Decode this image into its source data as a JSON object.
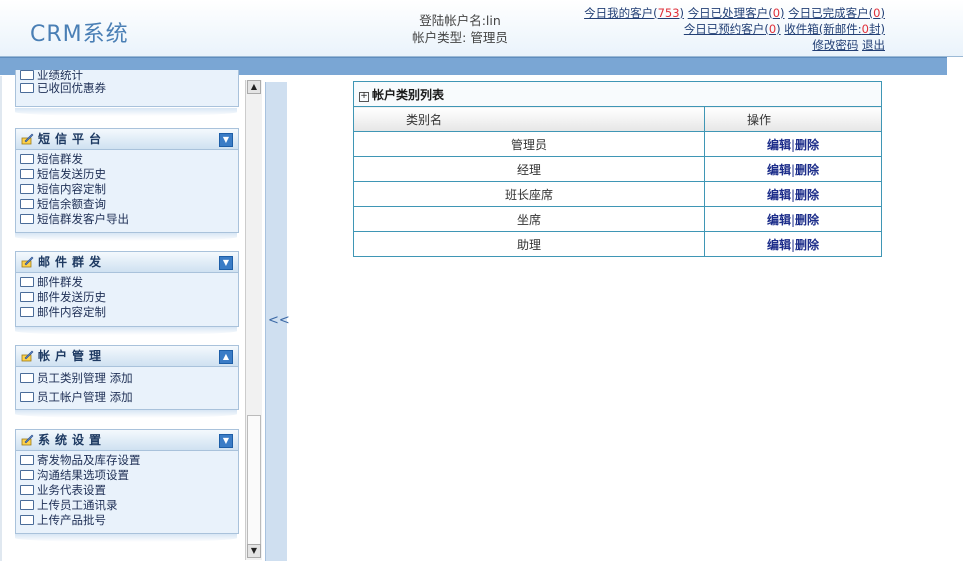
{
  "app": {
    "title": "CRM系统"
  },
  "login": {
    "user_label": "登陆帐户名:lin",
    "type_label": "帐户类型: 管理员"
  },
  "stats": {
    "my_customers_label": "今日我的客户",
    "my_customers_count": "753",
    "handled_label": "今日已处理客户",
    "handled_count": "0",
    "completed_label": "今日已完成客户",
    "completed_count": "0",
    "reserved_label": "今日已预约客户",
    "reserved_count": "0",
    "inbox_label": "收件箱(新邮件:",
    "inbox_count": "0",
    "inbox_suffix": "封)",
    "change_password": "修改密码",
    "logout": "退出"
  },
  "sidebar": {
    "partial_menu": {
      "items": [
        "业绩统计",
        "已收回优惠券"
      ]
    },
    "sms": {
      "title": "短信平台",
      "items": [
        "短信群发",
        "短信发送历史",
        "短信内容定制",
        "短信余额查询",
        "短信群发客户导出"
      ]
    },
    "mail": {
      "title": "邮件群发",
      "items": [
        "邮件群发",
        "邮件发送历史",
        "邮件内容定制"
      ]
    },
    "account": {
      "title": "帐户管理",
      "items": [
        {
          "label": "员工类别管理",
          "add": "添加"
        },
        {
          "label": "员工帐户管理",
          "add": "添加"
        }
      ]
    },
    "system": {
      "title": "系统设置",
      "items": [
        "寄发物品及库存设置",
        "沟通结果选项设置",
        "业务代表设置",
        "上传员工通讯录",
        "上传产品批号"
      ]
    }
  },
  "splitter": {
    "label": "<<"
  },
  "table": {
    "caption": "帐户类别列表",
    "columns": [
      "类别名",
      "操作"
    ],
    "rows": [
      {
        "name": "管理员",
        "edit": "编辑",
        "sep": "|",
        "delete": "删除"
      },
      {
        "name": "经理",
        "edit": "编辑",
        "sep": "|",
        "delete": "删除"
      },
      {
        "name": "班长座席",
        "edit": "编辑",
        "sep": "|",
        "delete": "删除"
      },
      {
        "name": "坐席",
        "edit": "编辑",
        "sep": "|",
        "delete": "删除"
      },
      {
        "name": "助理",
        "edit": "编辑",
        "sep": "|",
        "delete": "删除"
      }
    ]
  },
  "icons": {
    "folder": "folder-icon",
    "menu_title": "pencil-icon",
    "collapse": "collapse-icon",
    "expand": "expand-icon"
  },
  "colors": {
    "header_bar": "#7aa6d4",
    "count": "#e0303a",
    "link": "#223f75",
    "table_border": "#3f96b5"
  }
}
